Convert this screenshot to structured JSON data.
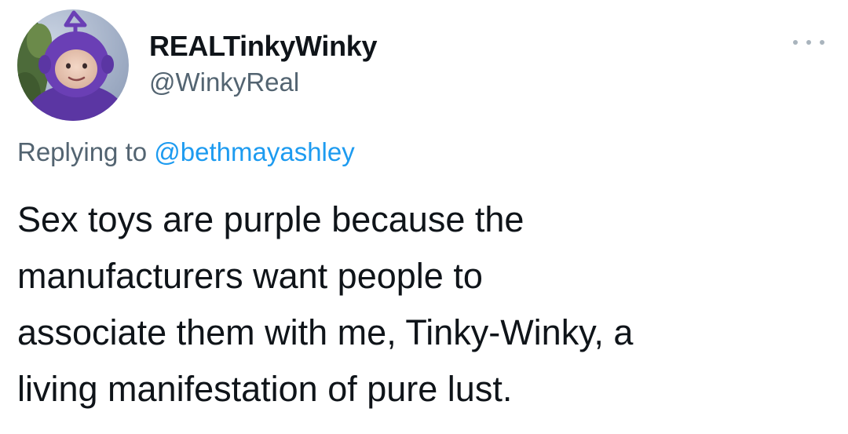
{
  "user": {
    "display_name": "REALTinkyWinky",
    "handle": "@WinkyReal",
    "avatar_icon": "teletubby-avatar-icon"
  },
  "menu": {
    "icon": "more-options-icon"
  },
  "reply": {
    "prefix": "Replying to",
    "mention": "@bethmayashley"
  },
  "tweet": {
    "lines": [
      "Sex toys are purple because the",
      "manufacturers want people to",
      "associate them with me, Tinky-Winky, a",
      "living manifestation of pure lust."
    ]
  },
  "colors": {
    "text": "#0f1419",
    "secondary": "#536471",
    "link": "#1d9bf0",
    "avatar_purple": "#6a3fb5"
  }
}
